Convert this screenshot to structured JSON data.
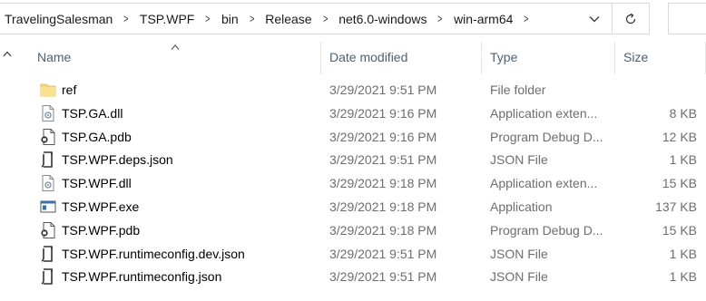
{
  "breadcrumb": [
    "TravelingSalesman",
    "TSP.WPF",
    "bin",
    "Release",
    "net6.0-windows",
    "win-arm64"
  ],
  "columns": {
    "name": "Name",
    "date": "Date modified",
    "type": "Type",
    "size": "Size"
  },
  "sort": {
    "column": "name",
    "direction": "ascending"
  },
  "files": [
    {
      "name": "ref",
      "date": "3/29/2021 9:51 PM",
      "type": "File folder",
      "size": "",
      "icon": "folder-icon"
    },
    {
      "name": "TSP.GA.dll",
      "date": "3/29/2021 9:16 PM",
      "type": "Application exten...",
      "size": "8 KB",
      "icon": "dll-file-icon"
    },
    {
      "name": "TSP.GA.pdb",
      "date": "3/29/2021 9:16 PM",
      "type": "Program Debug D...",
      "size": "12 KB",
      "icon": "pdb-file-icon"
    },
    {
      "name": "TSP.WPF.deps.json",
      "date": "3/29/2021 9:51 PM",
      "type": "JSON File",
      "size": "1 KB",
      "icon": "json-file-icon"
    },
    {
      "name": "TSP.WPF.dll",
      "date": "3/29/2021 9:18 PM",
      "type": "Application exten...",
      "size": "15 KB",
      "icon": "dll-file-icon"
    },
    {
      "name": "TSP.WPF.exe",
      "date": "3/29/2021 9:18 PM",
      "type": "Application",
      "size": "137 KB",
      "icon": "exe-file-icon"
    },
    {
      "name": "TSP.WPF.pdb",
      "date": "3/29/2021 9:18 PM",
      "type": "Program Debug D...",
      "size": "15 KB",
      "icon": "pdb-file-icon"
    },
    {
      "name": "TSP.WPF.runtimeconfig.dev.json",
      "date": "3/29/2021 9:51 PM",
      "type": "JSON File",
      "size": "1 KB",
      "icon": "json-file-icon"
    },
    {
      "name": "TSP.WPF.runtimeconfig.json",
      "date": "3/29/2021 9:51 PM",
      "type": "JSON File",
      "size": "1 KB",
      "icon": "json-file-icon"
    }
  ],
  "colors": {
    "header_text": "#4c607a",
    "meta_text": "#6d6d6d",
    "folder": "#f8d775"
  }
}
